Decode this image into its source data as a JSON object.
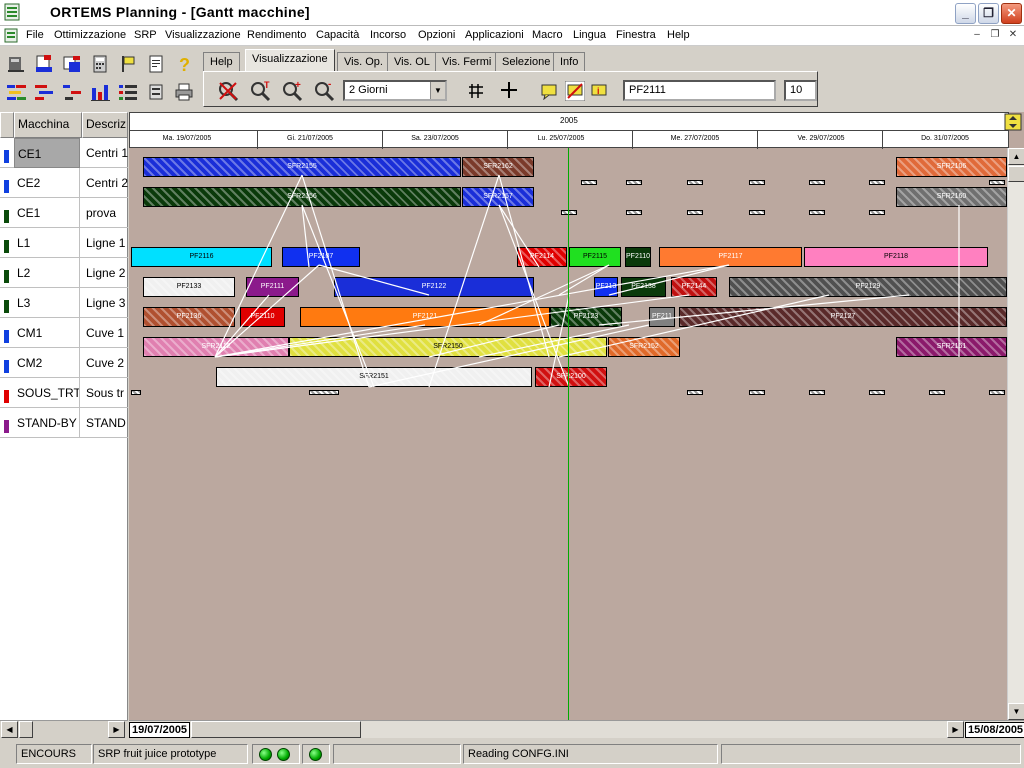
{
  "window": {
    "title": "ORTEMS   Planning - [Gantt macchine]"
  },
  "menu": [
    "File",
    "Ottimizzazione",
    "SRP",
    "Visualizzazione",
    "Rendimento",
    "Capacità",
    "Incorso",
    "Opzioni",
    "Applicazioni",
    "Macro",
    "Lingua",
    "Finestra",
    "Help"
  ],
  "tabs": [
    "Help",
    "Visualizzazione",
    "Vis. Op.",
    "Vis. OL",
    "Vis. Fermi",
    "Selezione",
    "Info"
  ],
  "active_tab": "Visualizzazione",
  "toolbar": {
    "period_select": "2 Giorni",
    "search_value": "PF2111",
    "count_value": "10"
  },
  "left_table": {
    "headers": [
      "Macchina",
      "Descriz"
    ],
    "rows": [
      {
        "code": "CE1",
        "desc": "Centri 1",
        "color": "#1040e0",
        "selected": true
      },
      {
        "code": "CE2",
        "desc": "Centri 2",
        "color": "#1040e0"
      },
      {
        "code": "CE1",
        "desc": "prova",
        "color": "#0a4a0a"
      },
      {
        "code": "L1",
        "desc": "Ligne 1",
        "color": "#0a4a0a"
      },
      {
        "code": "L2",
        "desc": "Ligne 2",
        "color": "#0a4a0a"
      },
      {
        "code": "L3",
        "desc": "Ligne 3",
        "color": "#0a4a0a"
      },
      {
        "code": "CM1",
        "desc": "Cuve 1",
        "color": "#1040e0"
      },
      {
        "code": "CM2",
        "desc": "Cuve 2",
        "color": "#1040e0"
      },
      {
        "code": "SOUS_TRT",
        "desc": "Sous tr",
        "color": "#e00000"
      },
      {
        "code": "STAND-BY",
        "desc": "STAND",
        "color": "#8b1a8b"
      }
    ]
  },
  "timeline": {
    "year": "2005",
    "days": [
      "Ma. 19/07/2005",
      "Gi. 21/07/2005",
      "Sa. 23/07/2005",
      "Lu. 25/07/2005",
      "Me. 27/07/2005",
      "Ve. 29/07/2005",
      "Do. 31/07/2005"
    ]
  },
  "gantt": {
    "rows": [
      {
        "bars": [
          {
            "label": "SFR2155",
            "color": "#1a2ed8"
          },
          {
            "label": "SFR2162",
            "color": "#7a3a2a"
          },
          {
            "label": "SFR2106",
            "color": "#e06a3a"
          }
        ]
      },
      {
        "bars": [
          {
            "label": "SFR2156",
            "color": "#0a3a0a"
          },
          {
            "label": "SFR2157",
            "color": "#1a2ed8"
          },
          {
            "label": "SFR2160",
            "color": "#707070"
          }
        ]
      },
      {
        "bars": []
      },
      {
        "bars": [
          {
            "label": "PF2116",
            "color": "#00e0ff"
          },
          {
            "label": "PF2107",
            "color": "#1030f0"
          },
          {
            "label": "PF2114",
            "color": "#e00000"
          },
          {
            "label": "PF2115",
            "color": "#20e020"
          },
          {
            "label": "PF2110",
            "color": "#0a3a0a"
          },
          {
            "label": "PF2117",
            "color": "#ff7a30"
          },
          {
            "label": "PF2118",
            "color": "#ff80c0"
          }
        ]
      },
      {
        "bars": [
          {
            "label": "PF2133",
            "color": "#f0f0f0"
          },
          {
            "label": "PF2111",
            "color": "#8b1a8b"
          },
          {
            "label": "PF2122",
            "color": "#1a2ed8"
          },
          {
            "label": "PF213",
            "color": "#1030f0"
          },
          {
            "label": "PF2138",
            "color": "#0a3a0a"
          },
          {
            "label": "PF2144",
            "color": "#c01010"
          },
          {
            "label": "PF2129",
            "color": "#505050"
          }
        ]
      },
      {
        "bars": [
          {
            "label": "PF2136",
            "color": "#b05030"
          },
          {
            "label": "PF2110",
            "color": "#e00000"
          },
          {
            "label": "PF2121",
            "color": "#ff7a10"
          },
          {
            "label": "PF2123",
            "color": "#0a3a0a"
          },
          {
            "label": "PF211",
            "color": "#808080"
          },
          {
            "label": "PF2127",
            "color": "#5a2a2a"
          }
        ]
      },
      {
        "bars": [
          {
            "label": "SFR2112",
            "color": "#e080b0"
          },
          {
            "label": "SFR2150",
            "color": "#e0e040"
          },
          {
            "label": "SFR2152",
            "color": "#e06a2a"
          },
          {
            "label": "SFR2161",
            "color": "#8b1a6b"
          }
        ]
      },
      {
        "bars": [
          {
            "label": "SFR2151",
            "color": "#f0f0f0"
          },
          {
            "label": "SFR2100",
            "color": "#d01010"
          }
        ]
      }
    ]
  },
  "hscroll": {
    "start_date": "19/07/2005",
    "end_date": "15/08/2005"
  },
  "status": {
    "mode": "ENCOURS",
    "project": "SRP fruit juice prototype",
    "message": "Reading CONFG.INI"
  }
}
